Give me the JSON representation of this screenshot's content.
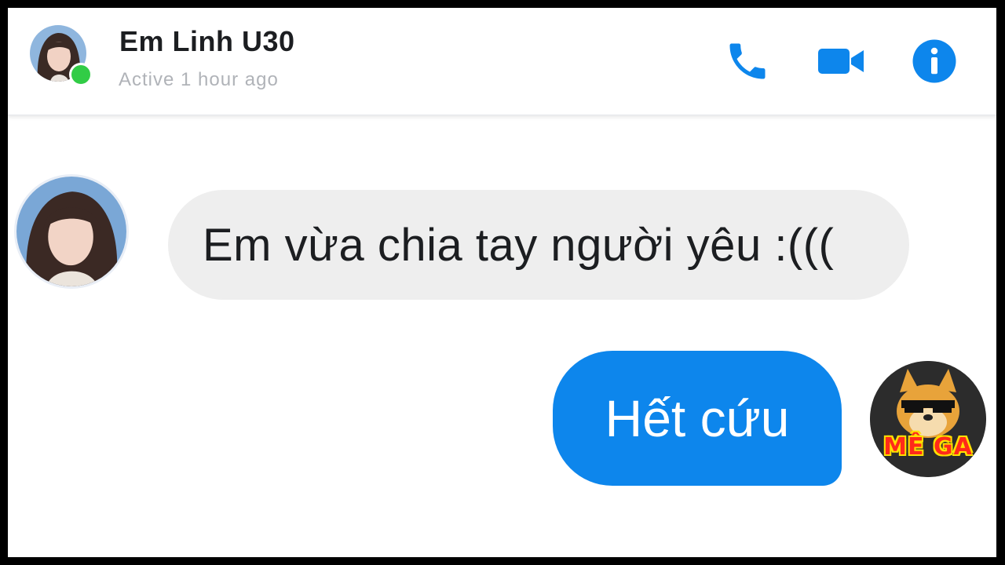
{
  "header": {
    "contact_name": "Em Linh U30",
    "status": "Active 1 hour ago",
    "icons": [
      "phone-icon",
      "video-camera-icon",
      "info-icon"
    ],
    "accent_color": "#0d86ec",
    "online_color": "#31cc46"
  },
  "messages": [
    {
      "sender": "contact",
      "text": "Em vừa chia tay người yêu :((("
    },
    {
      "sender": "self",
      "text": "Hết cứu"
    }
  ],
  "logo": {
    "text": "MÊ GA"
  }
}
